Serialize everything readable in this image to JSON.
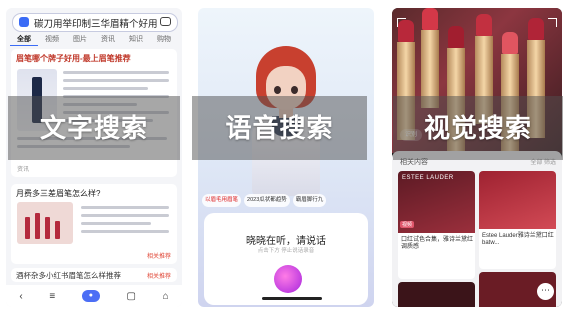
{
  "panel_text": {
    "search_query": "碳刀用举印制三华眉精个好用",
    "tabs": [
      "全部",
      "视频",
      "图片",
      "资讯",
      "知识",
      "购物"
    ],
    "result1_title": "眉笔哪个牌子好用-最上眉笔推荐",
    "result1_footer": "资讯",
    "result2_title": "月费多三差眉笔怎么样?",
    "result2_tag": "相关推荐",
    "result3_title": "酒杯杂多小红书眉笔怎么样推荐",
    "result3_tag": "相关推荐"
  },
  "voice": {
    "chips": [
      "以眉毛用眉笔",
      "2023瓜状都趋势",
      "霸眉脚行九"
    ],
    "listening": "晓晓在听，请说话",
    "hint": "点击下方 停止说话录音"
  },
  "visual": {
    "identify_label": "识别",
    "section_title": "相关内容",
    "filter_label": "全部 筛选",
    "brand": "ESTEE LAUDER",
    "result_tag": "视频",
    "result1_caption": "口红试色合集，雅诗兰黛红调质感",
    "result2_caption": "Estee Lauder雅诗兰黛口红 batw..."
  },
  "overlay": {
    "text_search": "文字搜索",
    "voice_search": "语音搜索",
    "visual_search": "视觉搜索"
  },
  "colors": {
    "accent_blue": "#3b6cf6",
    "highlight_red": "#c0392b",
    "orb_pink": "#d84ce6",
    "lipstick_red": "#9b2f3c"
  }
}
